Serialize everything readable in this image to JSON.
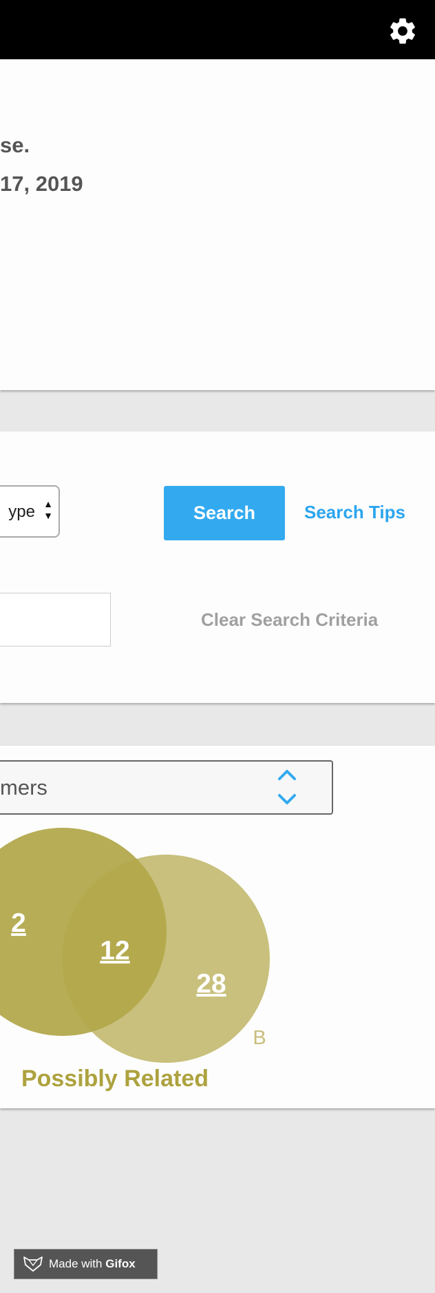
{
  "header": {
    "settings_icon": "gear-icon"
  },
  "info": {
    "line1": "se.",
    "line2": "17, 2019"
  },
  "search": {
    "type_select_value": "ype",
    "search_button": "Search",
    "search_tips_link": "Search Tips",
    "text_input_value": "",
    "clear_link": "Clear Search Criteria"
  },
  "results": {
    "dropdown_value": "mers",
    "venn": {
      "left_only": "2",
      "overlap": "12",
      "right_only": "28",
      "right_label": "B",
      "caption": "Possibly Related"
    }
  },
  "watermark": {
    "prefix": "Made with",
    "brand": "Gifox"
  },
  "colors": {
    "accent": "#33aaf0",
    "venn_dark": "#ada23f",
    "venn_light": "#c9be7c"
  }
}
